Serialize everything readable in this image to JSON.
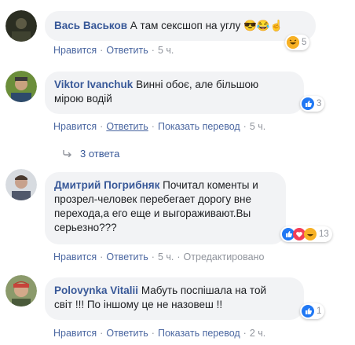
{
  "comments": [
    {
      "author": "Вась Васьков",
      "text": "А там сексшоп на углу",
      "emoji_text": "😎😂☝",
      "reaction_count": "5",
      "actions": {
        "like": "Нравится",
        "reply": "Ответить",
        "time": "5 ч."
      }
    },
    {
      "author": "Viktor Ivanchuk",
      "text_line1": "Винні обоє, але більшою",
      "text_line2": "мірою водій",
      "reaction_count": "3",
      "actions": {
        "like": "Нравится",
        "reply": "Ответить",
        "translate": "Показать перевод",
        "time": "5 ч."
      },
      "replies_label": "3 ответа"
    },
    {
      "author": "Дмитрий Погрибняк",
      "text_line1": "Почитал коменты и",
      "text_line2": "прозрел-человек перебегает дорогу вне",
      "text_line3": "перехода,а его еще и выгораживают.Вы",
      "text_line4": "серьезно???",
      "reaction_count": "13",
      "actions": {
        "like": "Нравится",
        "reply": "Ответить",
        "time": "5 ч.",
        "edited": "Отредактировано"
      }
    },
    {
      "author": "Polovynka Vitalii",
      "text_line1": "Мабуть поспішала на той",
      "text_line2": "світ !!! По іншому це не назовеш !!",
      "reaction_count": "1",
      "actions": {
        "like": "Нравится",
        "reply": "Ответить",
        "translate": "Показать перевод",
        "time": "2 ч."
      }
    }
  ],
  "colors": {
    "link": "#385898",
    "meta": "#90949c",
    "bubble": "#f2f3f5",
    "like": "#2078f4",
    "love": "#f33e58",
    "haha": "#f7b125"
  }
}
